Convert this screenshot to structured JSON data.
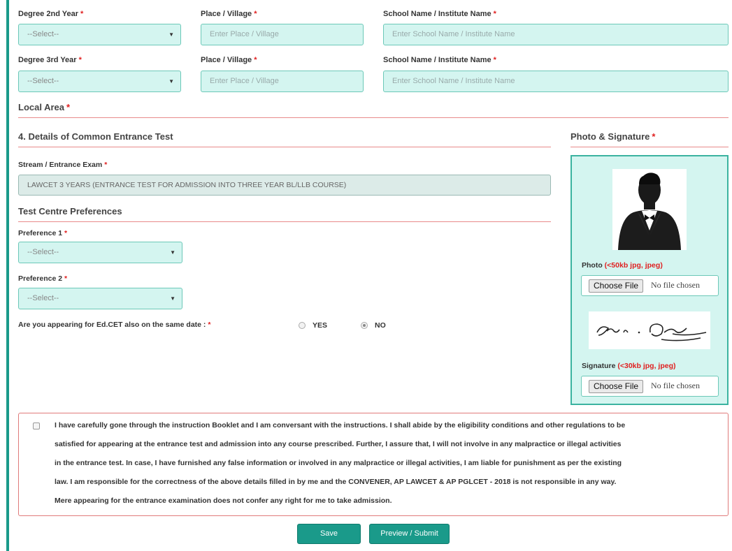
{
  "required_marker": "*",
  "education": {
    "rows": [
      {
        "degree_label": "Degree 2nd Year",
        "degree_value": "--Select--",
        "place_label": "Place / Village",
        "place_placeholder": "Enter Place / Village",
        "school_label": "School Name / Institute Name",
        "school_placeholder": "Enter School Name / Institute Name"
      },
      {
        "degree_label": "Degree 3rd Year",
        "degree_value": "--Select--",
        "place_label": "Place / Village",
        "place_placeholder": "Enter Place / Village",
        "school_label": "School Name / Institute Name",
        "school_placeholder": "Enter School Name / Institute Name"
      }
    ],
    "local_area_label": "Local Area"
  },
  "cet": {
    "section_title": "4. Details of Common Entrance Test",
    "stream_label": "Stream / Entrance Exam",
    "stream_value": "LAWCET 3 YEARS (ENTRANCE TEST FOR ADMISSION INTO THREE YEAR BL/LLB COURSE)",
    "test_centre_title": "Test Centre Preferences",
    "pref1_label": "Preference 1",
    "pref1_value": "--Select--",
    "pref2_label": "Preference 2",
    "pref2_value": "--Select--",
    "edcet_question_prefix": "Are you appearing for ",
    "edcet_question_bold": "Ed.CET",
    "edcet_question_suffix": " also on the same date :",
    "yes_label": "YES",
    "no_label": "NO",
    "selected": "NO"
  },
  "photo_signature": {
    "title": "Photo & Signature",
    "photo_label": "Photo",
    "photo_limit": "(<50kb jpg, jpeg)",
    "signature_label": "Signature",
    "signature_limit": "(<30kb jpg, jpeg)",
    "choose_file_label": "Choose File",
    "no_file_text": "No file chosen"
  },
  "declaration": {
    "lines": [
      "I have carefully gone through the instruction Booklet and I am conversant with the instructions. I shall abide by the eligibility conditions and other regulations to be",
      "satisfied for appearing at the entrance test and admission into any course prescribed. Further, I assure that, I will not involve in any malpractice or illegal activities",
      "in the entrance test. In case, I have furnished any false information or involved in any malpractice or illegal activities, I am liable for punishment as per the existing",
      "law. I am responsible for the correctness of the above details filled in by me and the CONVENER, AP LAWCET & AP PGLCET - 2018 is not responsible in any way.",
      "Mere appearing for the entrance examination does not confer any right for me to take admission."
    ]
  },
  "buttons": {
    "save": "Save",
    "preview_submit": "Preview / Submit"
  },
  "colors": {
    "accent": "#1a9a8a",
    "field_bg": "#d4f5f0",
    "required": "#e02020",
    "divider": "#e88a8a"
  }
}
